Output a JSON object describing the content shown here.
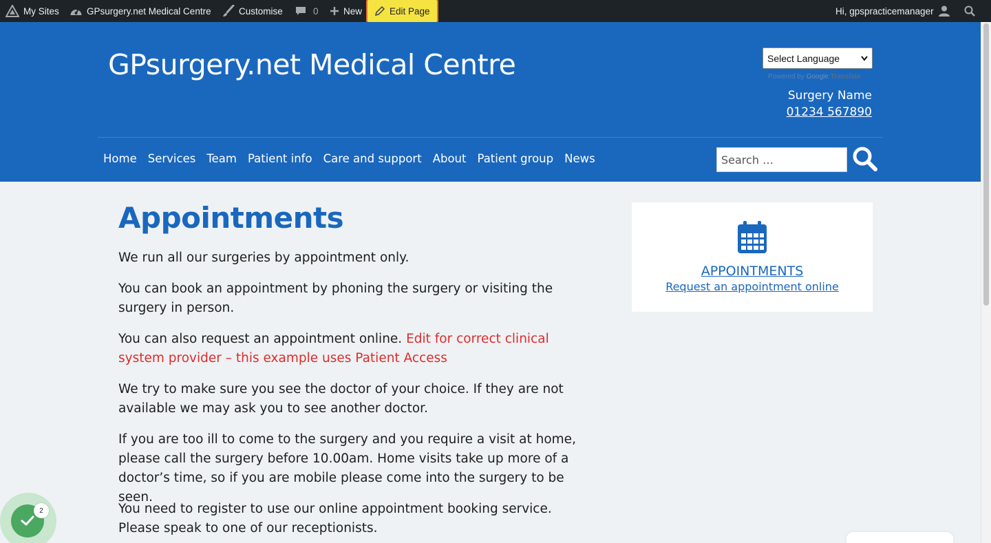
{
  "adminbar": {
    "my_sites": "My Sites",
    "site_name": "GPsurgery.net Medical Centre",
    "customise": "Customise",
    "comments_count": "0",
    "new": "New",
    "edit_page": "Edit Page",
    "greeting": "Hi, gpspracticemanager"
  },
  "header": {
    "site_title": "GPsurgery.net Medical Centre",
    "language_select": "Select Language",
    "powered_by": "Powered by",
    "google": "Google",
    "translate": "Translate",
    "surgery_name": "Surgery Name",
    "phone": "01234 567890"
  },
  "nav": {
    "items": [
      "Home",
      "Services",
      "Team",
      "Patient info",
      "Care and support",
      "About",
      "Patient group",
      "News"
    ]
  },
  "search": {
    "placeholder": "Search …"
  },
  "main": {
    "title": "Appointments",
    "p1": "We run all our surgeries by appointment only.",
    "p2": "You can book an appointment by phoning the surgery or visiting the surgery in person.",
    "p3_text": "You can also request an appointment online. ",
    "p3_note": "Edit for correct clinical system provider – this example uses Patient Access",
    "p4": "We try to make sure you see the doctor of your choice. If they are not available we may ask you to see another doctor.",
    "p5": "If you are too ill to come to the surgery and you require a visit at home, please call the surgery before 10.00am. Home visits take up more of a doctor’s time, so if you are mobile please come into the surgery to be seen.",
    "p6": "You need to register to use our online appointment booking service. Please speak to one of our receptionists."
  },
  "widget": {
    "title": "APPOINTMENTS",
    "link": "Request an appointment online",
    "icon": "calendar-icon"
  },
  "badge": {
    "count": "2"
  },
  "colors": {
    "brand_blue": "#1a67be",
    "admin_bar": "#1d2327",
    "edit_highlight": "#f5e342",
    "note_red": "#e02b2b",
    "check_green": "#4aa861"
  }
}
